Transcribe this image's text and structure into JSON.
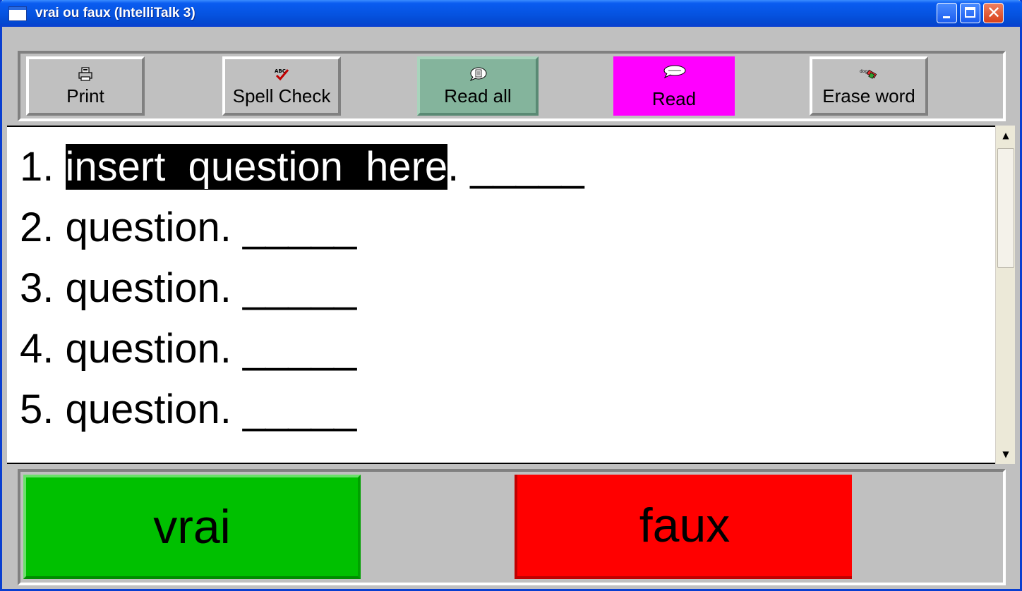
{
  "window": {
    "title": "vrai ou faux (IntelliTalk 3)",
    "controls": [
      "minimize",
      "maximize",
      "close"
    ]
  },
  "toolbar": {
    "buttons": [
      {
        "label": "Print",
        "icon": "printer-icon"
      },
      {
        "label": "Spell Check",
        "icon": "spell-check-icon"
      },
      {
        "label": "Read all",
        "icon": "speech-bubble-document-icon",
        "color": "#84b49c"
      },
      {
        "label": "Read",
        "icon": "speech-bubble-icon",
        "color": "#ff00ff"
      },
      {
        "label": "Erase word",
        "icon": "eraser-icon"
      }
    ]
  },
  "document": {
    "lines": [
      {
        "number": "1. ",
        "text": "insert  question  here",
        "suffix": ". _____",
        "selected": true
      },
      {
        "number": "2. ",
        "text": "question. _____"
      },
      {
        "number": "3. ",
        "text": "question. _____"
      },
      {
        "number": "4. ",
        "text": "question. _____"
      },
      {
        "number": "5. ",
        "text": "question. _____"
      }
    ]
  },
  "answers": {
    "true_label": "vrai",
    "true_color": "#00c000",
    "false_label": "faux",
    "false_color": "#ff0000"
  }
}
